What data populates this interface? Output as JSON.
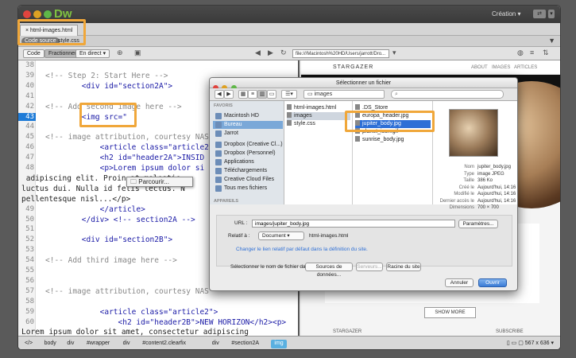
{
  "app": {
    "logo": "Dw",
    "workspace": "Création"
  },
  "document": {
    "tab_label": "html-images.html",
    "related_files": [
      "Code source",
      "style.css"
    ],
    "view_buttons": [
      "Code",
      "Fractionner",
      "En direct"
    ],
    "file_path": "file:///Macintosh%20HD/Users/jarrott/Dro..."
  },
  "code": {
    "lines": [
      {
        "n": "38",
        "t": ""
      },
      {
        "n": "39",
        "t": "<!-- Step 2: Start Here -->"
      },
      {
        "n": "40",
        "t": "        <div id=\"section2A\">"
      },
      {
        "n": "41",
        "t": ""
      },
      {
        "n": "42",
        "t": "<!-- Add second image here -->"
      },
      {
        "n": "43",
        "t": "        <img src=\""
      },
      {
        "n": "44",
        "t": ""
      },
      {
        "n": "45",
        "t": "<!-- image attribution, courtesy NAS"
      },
      {
        "n": "46",
        "t": "            <article class=\"article2"
      },
      {
        "n": "47",
        "t": "            <h2 id=\"header2A\">INSID"
      },
      {
        "n": "48",
        "t": "            <p>Lorem ipsum dolor si"
      },
      {
        "n": "",
        "t": " adipiscing elit. Proin at molestie"
      },
      {
        "n": "",
        "t": "luctus dui. Nulla id felis lectus. N"
      },
      {
        "n": "",
        "t": "pellentesque nisl...</p>"
      },
      {
        "n": "49",
        "t": "            </article>"
      },
      {
        "n": "50",
        "t": "        </div> <!-- section2A -->"
      },
      {
        "n": "51",
        "t": ""
      },
      {
        "n": "52",
        "t": "        <div id=\"section2B\">"
      },
      {
        "n": "53",
        "t": ""
      },
      {
        "n": "54",
        "t": "<!-- Add third image here -->"
      },
      {
        "n": "55",
        "t": ""
      },
      {
        "n": "56",
        "t": ""
      },
      {
        "n": "57",
        "t": "<!-- image attribution, courtesy NAS"
      },
      {
        "n": "58",
        "t": ""
      },
      {
        "n": "59",
        "t": "            <article class=\"article2\">"
      },
      {
        "n": "60",
        "t": "                <h2 id=\"header2B\">NEW HORIZON</h2><p>"
      },
      {
        "n": "",
        "t": "Lorem ipsum dolor sit amet, consectetur adipiscing"
      }
    ],
    "current_line": "43",
    "hint_popup": "Parcourir..."
  },
  "preview": {
    "brand": "STARGAZER",
    "nav": [
      "ABOUT",
      "IMAGES",
      "ARTICLES"
    ],
    "show_more": "SHOW MORE",
    "footer_left": "STARGAZER",
    "footer_right": "SUBSCRIBE"
  },
  "status": {
    "breadcrumb": [
      "</>",
      "body",
      "div",
      "#wrapper",
      "div",
      "#content2.clearfix",
      "div",
      "#section2A",
      "img"
    ],
    "size": "567 x 636"
  },
  "dialog": {
    "title": "Sélectionner un fichier",
    "folder": "images",
    "search_placeholder": "",
    "favorites_header": "FAVORIS",
    "devices_header": "APPAREILS",
    "sidebar": [
      "Macintosh HD",
      "Bureau",
      "Jarrot",
      "Dropbox (Creative Cl...)",
      "Dropbox (Personnel)",
      "Applications",
      "Téléchargements",
      "Creative Cloud Files",
      "Tous mes fichiers"
    ],
    "sidebar_selected": 1,
    "col1": [
      "html-images.html",
      "images",
      "style.css"
    ],
    "col2": [
      ".DS_Store",
      "europa_header.jpg",
      "jupiter_body.jpg",
      "planet_icon.gif",
      "sunrise_body.jpg"
    ],
    "col2_selected": 2,
    "info": [
      {
        "k": "Nom",
        "v": "jupiter_body.jpg"
      },
      {
        "k": "Type",
        "v": "image JPEG"
      },
      {
        "k": "Taille",
        "v": "386 Ko"
      },
      {
        "k": "Créé le",
        "v": "Aujourd'hui, 14:16"
      },
      {
        "k": "Modifié le",
        "v": "Aujourd'hui, 14:16"
      },
      {
        "k": "Dernier accès le",
        "v": "Aujourd'hui, 14:16"
      },
      {
        "k": "Dimensions",
        "v": "700 × 700"
      }
    ],
    "url_label": "URL :",
    "url_value": "images/jupiter_body.jpg",
    "params_button": "Paramètres...",
    "relative_label": "Relatif à :",
    "relative_value": "Document",
    "relative_file": "html-images.html",
    "link_text": "Changer le lien relatif par défaut dans la définition du site.",
    "datasource_label": "Sélectionner le nom de fichier dans :",
    "datasource_button": "Sources de données...",
    "servers_button": "Serveurs...",
    "root_button": "Racine du site",
    "cancel_button": "Annuler",
    "open_button": "Ouvrir"
  }
}
